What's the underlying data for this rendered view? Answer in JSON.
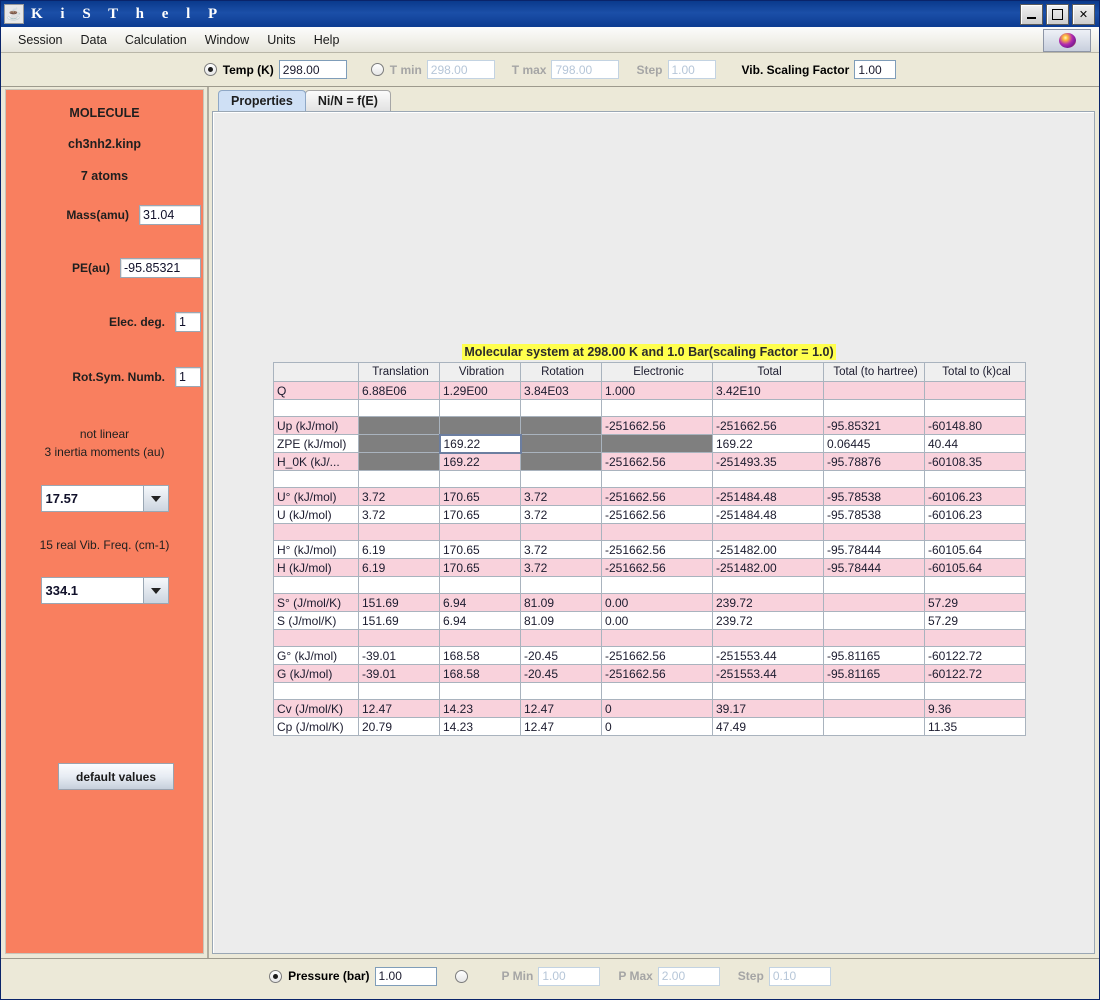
{
  "window": {
    "title": "K i S T h e l P",
    "icon": "java-coffee-icon",
    "minimize_label": "minimize",
    "maximize_label": "maximize",
    "close_label": "✕"
  },
  "menubar": {
    "items": [
      "Session",
      "Data",
      "Calculation",
      "Window",
      "Units",
      "Help"
    ],
    "logo": "kistherp-sphere-logo"
  },
  "temperature_bar": {
    "temp_radio_selected": true,
    "temp_label": "Temp (K)",
    "temp_value": "298.00",
    "range_radio_selected": false,
    "tmin_label": "T min",
    "tmin_value": "298.00",
    "tmax_label": "T max",
    "tmax_value": "798.00",
    "step_label": "Step",
    "step_value": "1.00",
    "vib_label": "Vib. Scaling Factor",
    "vib_value": "1.00"
  },
  "sidebar": {
    "title": "MOLECULE",
    "filename": "ch3nh2.kinp",
    "atoms": "7 atoms",
    "mass_label": "Mass(amu)",
    "mass_value": "31.04",
    "pe_label": "PE(au)",
    "pe_value": "-95.85321",
    "elec_label": "Elec. deg.",
    "elec_value": "1",
    "rotsym_label": "Rot.Sym. Numb.",
    "rotsym_value": "1",
    "linearity": "not linear",
    "inertia_label": "3 inertia moments (au)",
    "inertia_value": "17.57",
    "freq_label": "15 real Vib. Freq. (cm-1)",
    "freq_value": "334.1",
    "default_button": "default values"
  },
  "tabs": [
    {
      "label": "Properties",
      "active": true
    },
    {
      "label": "Ni/N = f(E)",
      "active": false
    }
  ],
  "table": {
    "title": "Molecular system at 298.00 K and 1.0 Bar(scaling Factor = 1.0)",
    "columns": [
      "",
      "Translation",
      "Vibration",
      "Rotation",
      "Electronic",
      "Total",
      "Total (to hartree)",
      "Total to (k)cal"
    ],
    "rows": [
      {
        "style": "pink",
        "cells": [
          "Q",
          "6.88E06",
          "1.29E00",
          "3.84E03",
          "1.000",
          "3.42E10",
          "",
          ""
        ]
      },
      {
        "style": "spacer-white",
        "cells": [
          "",
          "",
          "",
          "",
          "",
          "",
          "",
          ""
        ]
      },
      {
        "style": "pink",
        "cells": [
          "Up (kJ/mol)",
          "",
          "",
          "",
          "-251662.56",
          "-251662.56",
          "-95.85321",
          "-60148.80"
        ],
        "gray": [
          1,
          2,
          3
        ]
      },
      {
        "style": "white",
        "cells": [
          "ZPE (kJ/mol)",
          "",
          "169.22",
          "",
          "",
          "169.22",
          "0.06445",
          "40.44"
        ],
        "gray": [
          1,
          3,
          4
        ],
        "selected": [
          2
        ]
      },
      {
        "style": "pink",
        "cells": [
          "H_0K (kJ/...",
          "",
          "169.22",
          "",
          "-251662.56",
          "-251493.35",
          "-95.78876",
          "-60108.35"
        ],
        "gray": [
          1,
          3
        ]
      },
      {
        "style": "spacer-white",
        "cells": [
          "",
          "",
          "",
          "",
          "",
          "",
          "",
          ""
        ]
      },
      {
        "style": "pink",
        "cells": [
          "U° (kJ/mol)",
          "3.72",
          "170.65",
          "3.72",
          "-251662.56",
          "-251484.48",
          "-95.78538",
          "-60106.23"
        ]
      },
      {
        "style": "white",
        "cells": [
          "U  (kJ/mol)",
          "3.72",
          "170.65",
          "3.72",
          "-251662.56",
          "-251484.48",
          "-95.78538",
          "-60106.23"
        ]
      },
      {
        "style": "spacer-pink",
        "cells": [
          "",
          "",
          "",
          "",
          "",
          "",
          "",
          ""
        ]
      },
      {
        "style": "white",
        "cells": [
          "H° (kJ/mol)",
          "6.19",
          "170.65",
          "3.72",
          "-251662.56",
          "-251482.00",
          "-95.78444",
          "-60105.64"
        ]
      },
      {
        "style": "pink",
        "cells": [
          "H  (kJ/mol)",
          "6.19",
          "170.65",
          "3.72",
          "-251662.56",
          "-251482.00",
          "-95.78444",
          "-60105.64"
        ]
      },
      {
        "style": "spacer-white",
        "cells": [
          "",
          "",
          "",
          "",
          "",
          "",
          "",
          ""
        ]
      },
      {
        "style": "pink",
        "cells": [
          "S° (J/mol/K)",
          "151.69",
          "6.94",
          "81.09",
          "0.00",
          "239.72",
          "",
          "57.29"
        ]
      },
      {
        "style": "white",
        "cells": [
          "S  (J/mol/K)",
          "151.69",
          "6.94",
          "81.09",
          "0.00",
          "239.72",
          "",
          "57.29"
        ]
      },
      {
        "style": "spacer-pink",
        "cells": [
          "",
          "",
          "",
          "",
          "",
          "",
          "",
          ""
        ]
      },
      {
        "style": "white",
        "cells": [
          "G° (kJ/mol)",
          "-39.01",
          "168.58",
          "-20.45",
          "-251662.56",
          "-251553.44",
          "-95.81165",
          "-60122.72"
        ]
      },
      {
        "style": "pink",
        "cells": [
          "G  (kJ/mol)",
          "-39.01",
          "168.58",
          "-20.45",
          "-251662.56",
          "-251553.44",
          "-95.81165",
          "-60122.72"
        ]
      },
      {
        "style": "spacer-white",
        "cells": [
          "",
          "",
          "",
          "",
          "",
          "",
          "",
          ""
        ]
      },
      {
        "style": "pink",
        "cells": [
          "Cv (J/mol/K)",
          "12.47",
          "14.23",
          "12.47",
          "0",
          "39.17",
          "",
          "9.36"
        ]
      },
      {
        "style": "white",
        "cells": [
          "Cp (J/mol/K)",
          "20.79",
          "14.23",
          "12.47",
          "0",
          "47.49",
          "",
          "11.35"
        ]
      }
    ]
  },
  "pressure_bar": {
    "pressure_radio_selected": true,
    "pressure_label": "Pressure (bar)",
    "pressure_value": "1.00",
    "range_radio_selected": false,
    "pmin_label": "P Min",
    "pmin_value": "1.00",
    "pmax_label": "P Max",
    "pmax_value": "2.00",
    "step_label": "Step",
    "step_value": "0.10"
  },
  "colors": {
    "titlebar": "#0a3a8c",
    "sidebar_bg": "#f97f5f",
    "row_pink": "#f9d2dc",
    "cell_gray": "#7f7f7f",
    "title_highlight": "#ffff4d",
    "tab_active": "#cfe0f5"
  }
}
